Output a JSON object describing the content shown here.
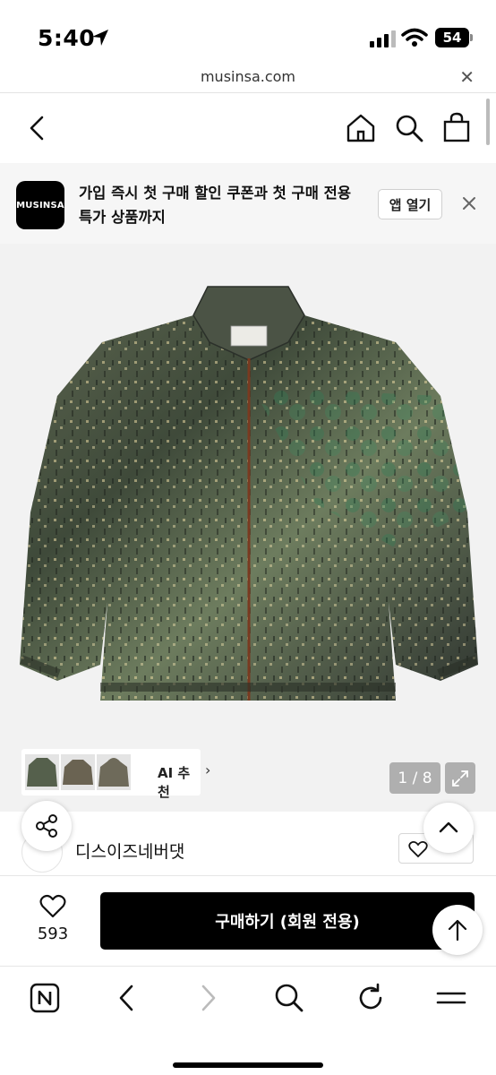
{
  "status": {
    "time": "5:40",
    "battery": "54"
  },
  "browser": {
    "url": "musinsa.com",
    "close_glyph": "✕"
  },
  "nav": {
    "back_icon": "chevron-left-icon",
    "home_icon": "home-icon",
    "search_icon": "search-icon",
    "cart_icon": "bag-icon"
  },
  "promo": {
    "logo_text": "MUSINSA",
    "message": "가입 즉시 첫 구매 할인 쿠폰과 첫 구매 전용 특가 상품까지",
    "open_app_label": "앱 열기",
    "close_glyph": "✕"
  },
  "gallery": {
    "ai_label": "AI 추천",
    "ai_chevron": "›",
    "counter": "1 / 8"
  },
  "brand": {
    "name": "디스이즈네버댓"
  },
  "buy": {
    "likes": "593",
    "button_label": "구매하기 (회원 전용)"
  },
  "colors": {
    "accent": "#000000",
    "background": "#f2f2f2"
  }
}
